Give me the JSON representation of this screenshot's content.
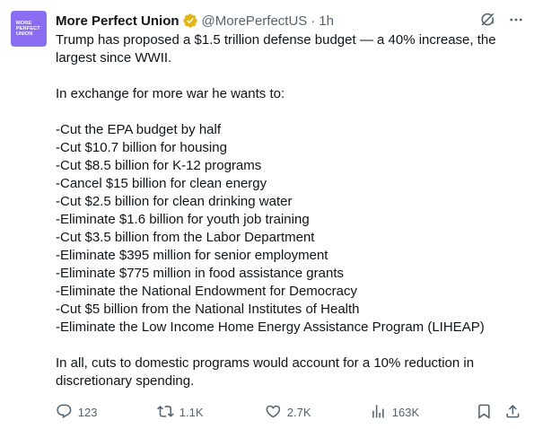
{
  "tweet": {
    "avatar_text": [
      "MORE",
      "PERFECT",
      "UNION"
    ],
    "author_name": "More Perfect Union",
    "handle": "@MorePerfectUS",
    "separator": "·",
    "time": "1h",
    "lines": [
      "Trump has proposed a $1.5 trillion defense budget — a 40% increase, the",
      "largest since WWII.",
      "",
      "In exchange for more war he wants to:",
      "",
      "-Cut the EPA budget by half",
      "-Cut $10.7 billion for housing",
      "-Cut $8.5 billion for K-12 programs",
      "-Cancel $15 billion for clean energy",
      "-Cut $2.5 billion for clean drinking water",
      "-Eliminate $1.6 billion for youth job training",
      "-Cut $3.5 billion from the Labor Department",
      "-Eliminate $395 million for senior employment",
      "-Eliminate $775 million in food assistance grants",
      "-Eliminate the National Endowment for Democracy",
      "-Cut $5 billion from the National Institutes of Health",
      "-Eliminate the Low Income Home Energy Assistance Program (LIHEAP)",
      "",
      "In all, cuts to domestic programs would account for a 10% reduction in",
      "discretionary spending."
    ],
    "stats": {
      "replies": "123",
      "reposts": "1.1K",
      "likes": "2.7K",
      "views": "163K"
    }
  },
  "icons": {
    "verified": "verified-badge-icon",
    "grok": "grok-icon",
    "more": "more-icon",
    "reply": "reply-icon",
    "repost": "repost-icon",
    "like": "heart-icon",
    "views": "views-icon",
    "bookmark": "bookmark-icon",
    "share": "share-icon"
  },
  "colors": {
    "avatar_bg": "#8a6df0",
    "verified": "#e2b719",
    "text": "#0f1419",
    "muted": "#536471"
  }
}
